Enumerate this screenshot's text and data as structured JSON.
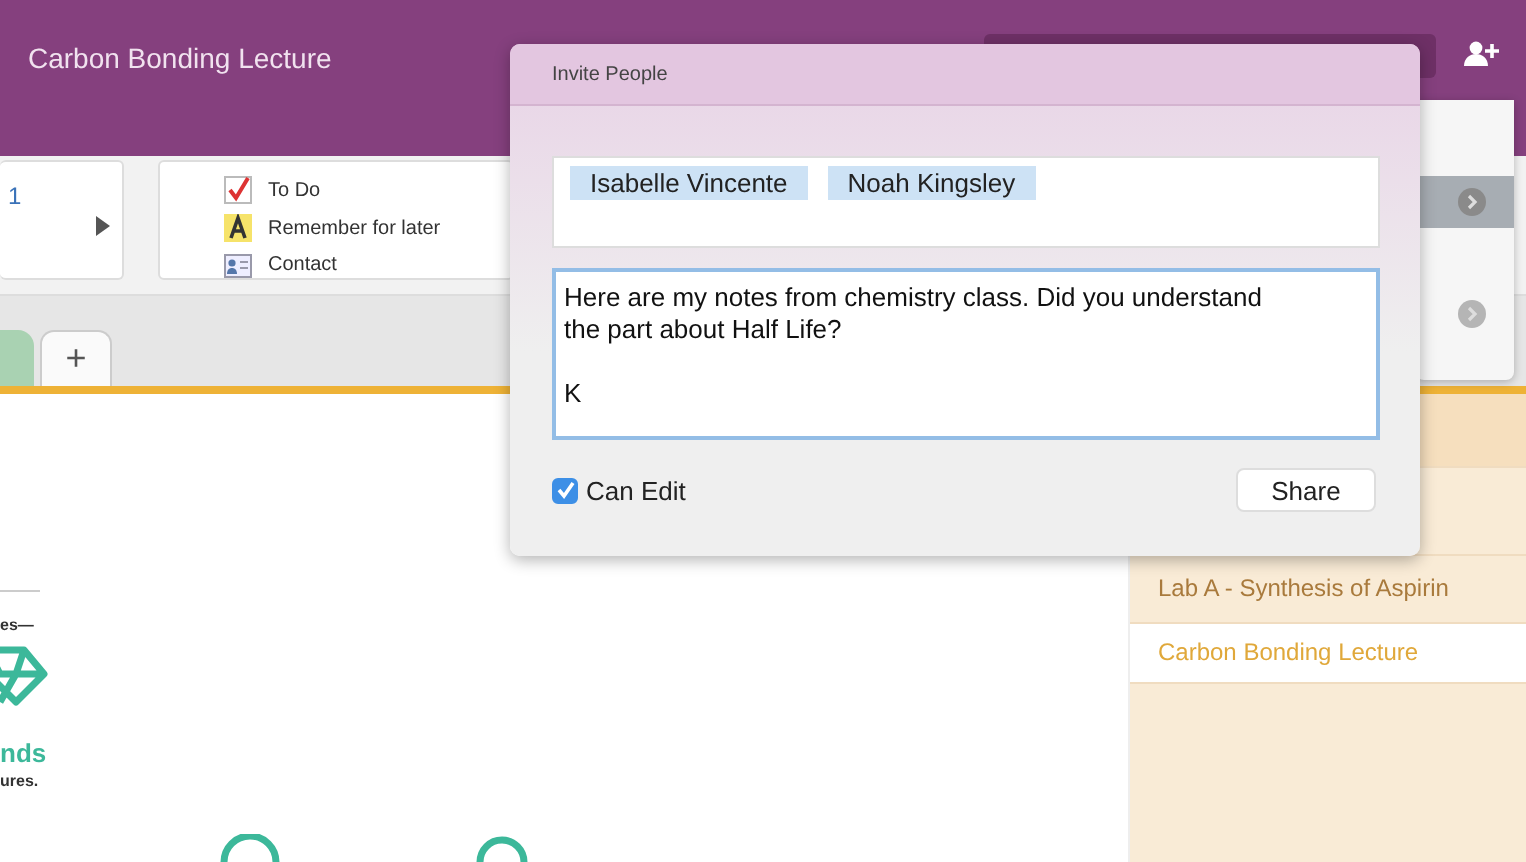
{
  "window": {
    "title": "Carbon Bonding Lecture"
  },
  "ribbon": {
    "group_1": {
      "text": "1"
    },
    "tags": [
      {
        "kind": "todo",
        "label": "To Do"
      },
      {
        "kind": "remember",
        "label": "Remember for later"
      },
      {
        "kind": "contact",
        "label": "Contact"
      }
    ]
  },
  "add_tab": {
    "label": "+"
  },
  "canvas": {
    "texts": [
      {
        "kind": "caption",
        "text": "es—"
      },
      {
        "kind": "heading",
        "text": "nds"
      },
      {
        "kind": "caption",
        "text": "ures."
      }
    ]
  },
  "pages": [
    {
      "title": "Lab A - Synthesis of Aspirin",
      "selected": false
    },
    {
      "title": "Carbon Bonding Lecture",
      "selected": true
    }
  ],
  "invite_dialog": {
    "title": "Invite People",
    "recipients": [
      "Isabelle Vincente",
      "Noah Kingsley"
    ],
    "message": "Here are my notes from chemistry class. Did you understand the part about Half Life?\n\nK",
    "can_edit": {
      "label": "Can Edit",
      "checked": true
    },
    "share_button": "Share"
  }
}
